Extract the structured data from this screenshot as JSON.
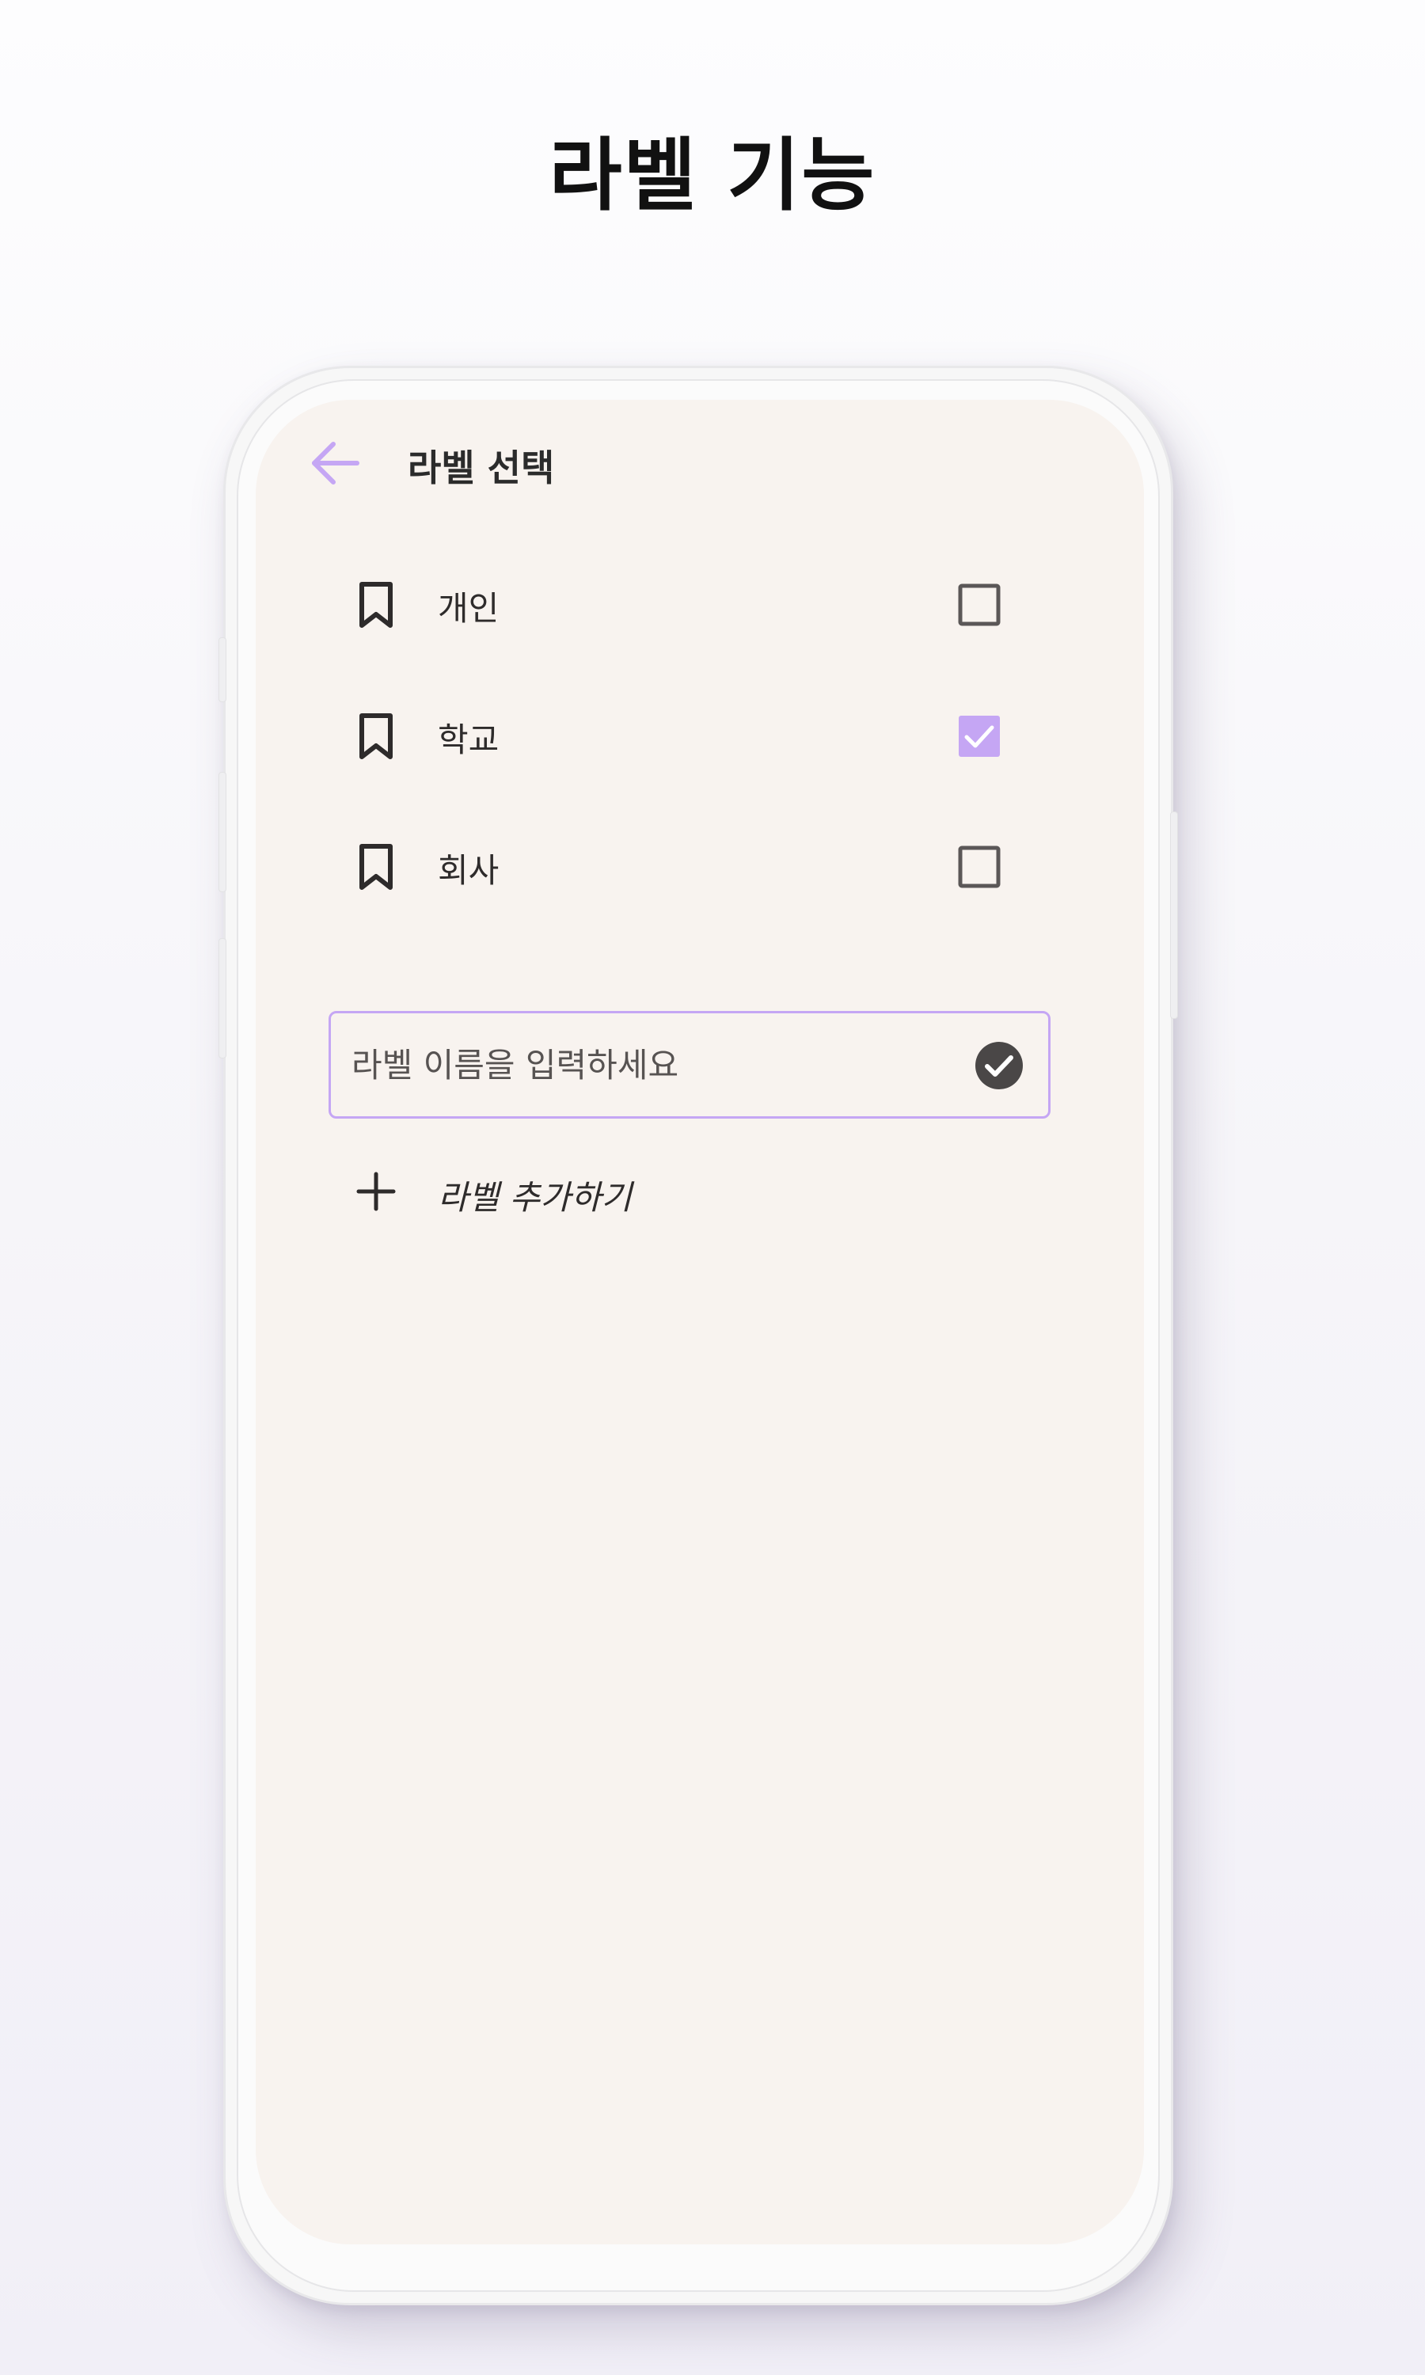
{
  "headline": "라벨 기능",
  "screen": {
    "app_bar": {
      "back_icon": "arrow-left-icon",
      "title": "라벨 선택"
    },
    "labels": [
      {
        "name": "개인",
        "icon": "bookmark-icon",
        "checked": false
      },
      {
        "name": "학교",
        "icon": "bookmark-icon",
        "checked": true
      },
      {
        "name": "회사",
        "icon": "bookmark-icon",
        "checked": false
      }
    ],
    "new_label_input": {
      "value": "",
      "placeholder": "라벨 이름을 입력하세요",
      "confirm_icon": "check-circle-icon"
    },
    "add_label": {
      "icon": "plus-icon",
      "label": "라벨 추가하기"
    }
  },
  "colors": {
    "accent": "#c5a6f4",
    "screen_background": "#f8f3ef",
    "text_primary": "#2e2b2b",
    "checkbox_border": "#5b5757",
    "confirm_fill": "#4a4747"
  }
}
